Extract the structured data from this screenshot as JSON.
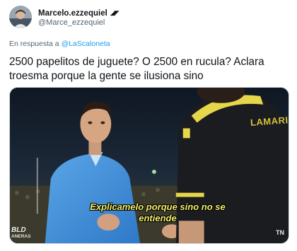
{
  "author": {
    "display_name": "Marcelo.ezzequiel",
    "name_emoji": "◢◤",
    "handle": "@Marce_ezzequiel",
    "more_icon": "more-dots-icon"
  },
  "reply": {
    "prefix": "En respuesta a",
    "target": "@LaScaloneta"
  },
  "tweet": {
    "text": "2500 papelitos de juguete? O 2500 en rucula? Aclara troesma porque la gente se ilusiona sino"
  },
  "media": {
    "subtitle_line1": "Explicamelo porque sino no se",
    "subtitle_line2": "entiende",
    "jersey_text": "LAMARI",
    "watermark_left": "BLD",
    "watermark_left_small": "ANERAS",
    "watermark_right": "TN"
  },
  "colors": {
    "link": "#1d9bf0",
    "secondary_text": "#536471",
    "subtitle": "#f4f06a"
  }
}
